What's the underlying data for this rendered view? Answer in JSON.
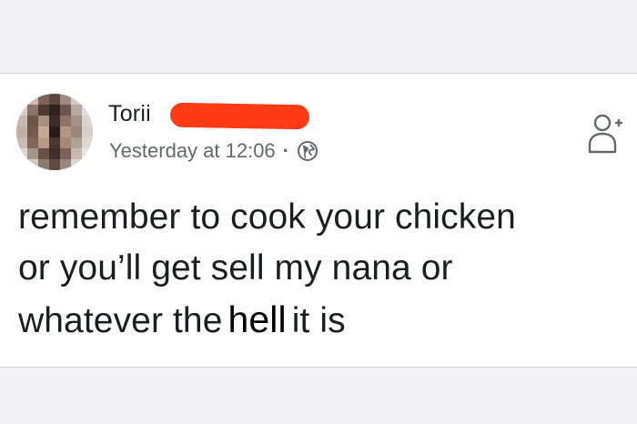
{
  "post": {
    "author_name": "Torii",
    "timestamp": "Yesterday at 12:06",
    "separator": "·",
    "visibility_icon": "globe-icon",
    "action_icon": "add-friend-icon",
    "body": {
      "line1": "remember to cook your chicken",
      "line2": "or you’ll get sell my nana or",
      "line3_start": "whatever the",
      "line3_emphasis": "hell",
      "line3_end": "it is"
    }
  },
  "colors": {
    "redaction": "#ff3b16",
    "text_primary": "#1c1e21",
    "text_secondary": "#65676b",
    "page_background": "#f2f2f4",
    "card_background": "#ffffff"
  }
}
